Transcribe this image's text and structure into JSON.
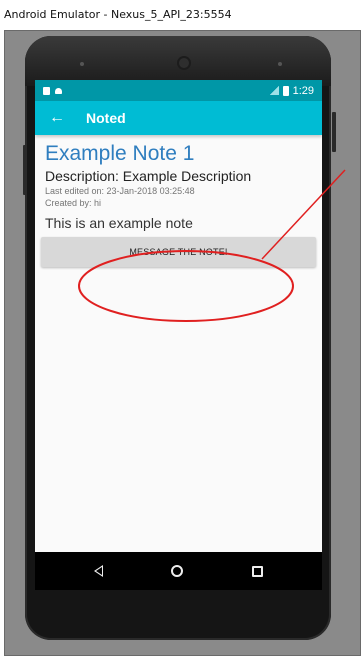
{
  "window": {
    "title": "Android Emulator - Nexus_5_API_23:5554"
  },
  "status_bar": {
    "time": "1:29"
  },
  "app_bar": {
    "title": "Noted",
    "back_icon": "arrow-back-icon"
  },
  "note": {
    "title": "Example Note 1",
    "description": "Description: Example Description",
    "last_edited": "Last edited on: 23-Jan-2018 03:25:48",
    "created_by": "Created by: hi",
    "body": "This is an example note"
  },
  "actions": {
    "message_button_label": "MESSAGE THE NOTE!"
  },
  "nav_bar": {
    "icons": [
      "nav-back-icon",
      "nav-home-icon",
      "nav-recents-icon"
    ]
  },
  "colors": {
    "app_bar": "#00bcd4",
    "status_bar": "#0097a7",
    "title_text": "#2f7ebf",
    "annotation": "#e02020"
  }
}
